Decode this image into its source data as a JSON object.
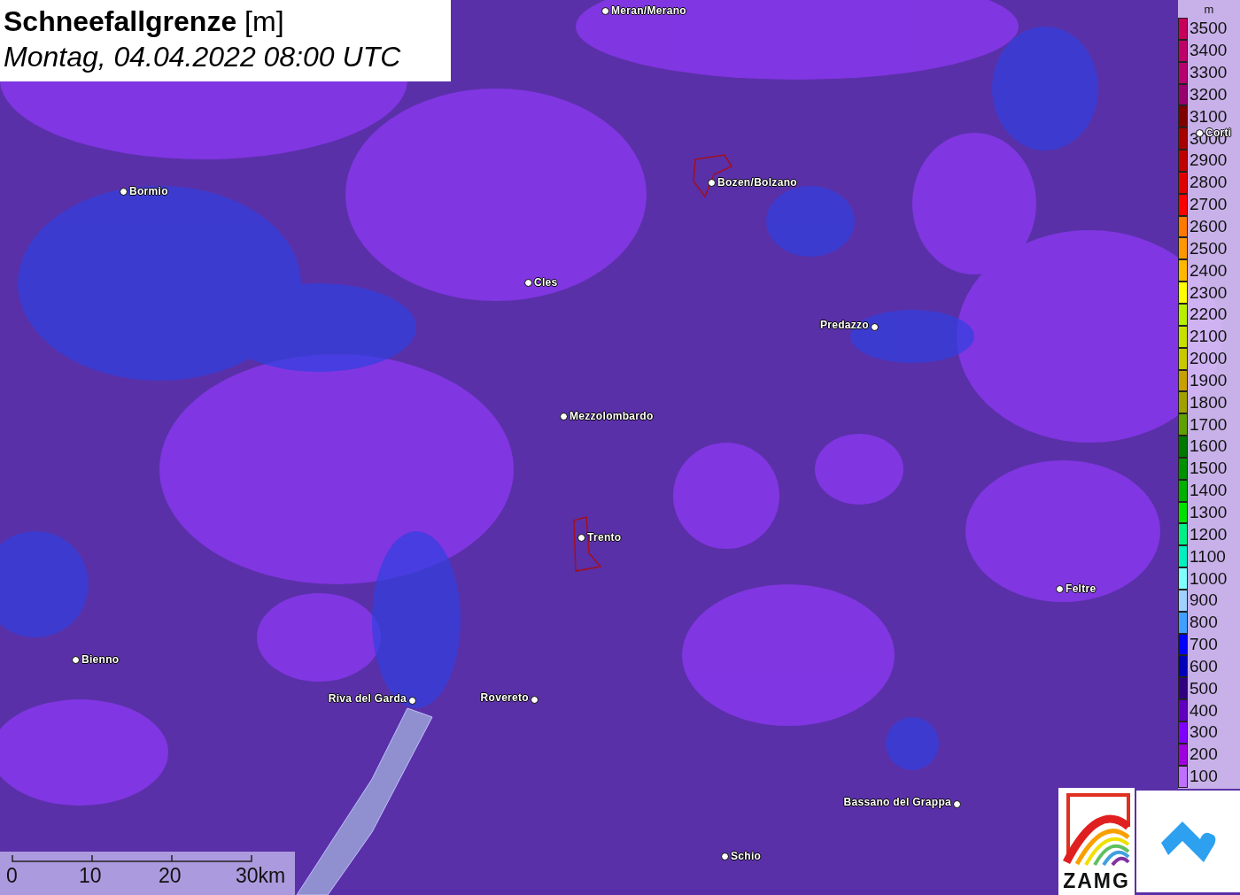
{
  "title": {
    "heading": "**Schneefallgrenze** [m]",
    "time": "Montag, 04.04.2022 08:00 UTC"
  },
  "cities": [
    {
      "name": "Meran/Merano"
    },
    {
      "name": "Corti"
    },
    {
      "name": "Bormio"
    },
    {
      "name": "Bozen/Bolzano"
    },
    {
      "name": "Cles"
    },
    {
      "name": "Predazzo"
    },
    {
      "name": "Mezzolombardo"
    },
    {
      "name": "Trento"
    },
    {
      "name": "Feltre"
    },
    {
      "name": "Bienno"
    },
    {
      "name": "Riva del Garda"
    },
    {
      "name": "Rovereto"
    },
    {
      "name": "Bassano del Grappa"
    },
    {
      "name": "Schio"
    }
  ],
  "legend": {
    "unit": "m",
    "items": [
      {
        "label": "3500",
        "color": "#c8005a"
      },
      {
        "label": "3400",
        "color": "#c0006a"
      },
      {
        "label": "3300",
        "color": "#b80070"
      },
      {
        "label": "3200",
        "color": "#980070"
      },
      {
        "label": "3100",
        "color": "#800000"
      },
      {
        "label": "3000",
        "color": "#a80000"
      },
      {
        "label": "2900",
        "color": "#c00000"
      },
      {
        "label": "2800",
        "color": "#e00000"
      },
      {
        "label": "2700",
        "color": "#ff0000"
      },
      {
        "label": "2600",
        "color": "#ff7800"
      },
      {
        "label": "2500",
        "color": "#ff9800"
      },
      {
        "label": "2400",
        "color": "#ffb800"
      },
      {
        "label": "2300",
        "color": "#ffff00"
      },
      {
        "label": "2200",
        "color": "#b8f000"
      },
      {
        "label": "2100",
        "color": "#c8e000"
      },
      {
        "label": "2000",
        "color": "#c8c800"
      },
      {
        "label": "1900",
        "color": "#c8a000"
      },
      {
        "label": "1800",
        "color": "#a0a000"
      },
      {
        "label": "1700",
        "color": "#60a000"
      },
      {
        "label": "1600",
        "color": "#007800"
      },
      {
        "label": "1500",
        "color": "#009000"
      },
      {
        "label": "1400",
        "color": "#00b000"
      },
      {
        "label": "1300",
        "color": "#00e000"
      },
      {
        "label": "1200",
        "color": "#00f088"
      },
      {
        "label": "1100",
        "color": "#00f0c0"
      },
      {
        "label": "1000",
        "color": "#80ffff"
      },
      {
        "label": "900",
        "color": "#a0d0ff"
      },
      {
        "label": "800",
        "color": "#40a0ff"
      },
      {
        "label": "700",
        "color": "#0000ff"
      },
      {
        "label": "600",
        "color": "#0000b8"
      },
      {
        "label": "500",
        "color": "#300080"
      },
      {
        "label": "400",
        "color": "#6000c0"
      },
      {
        "label": "300",
        "color": "#8000ff"
      },
      {
        "label": "200",
        "color": "#a000e0"
      },
      {
        "label": "100",
        "color": "#c070ff"
      }
    ]
  },
  "scale": {
    "ticks": [
      "0",
      "10",
      "20",
      "30km"
    ]
  },
  "logo": {
    "text": "ZAMG"
  }
}
